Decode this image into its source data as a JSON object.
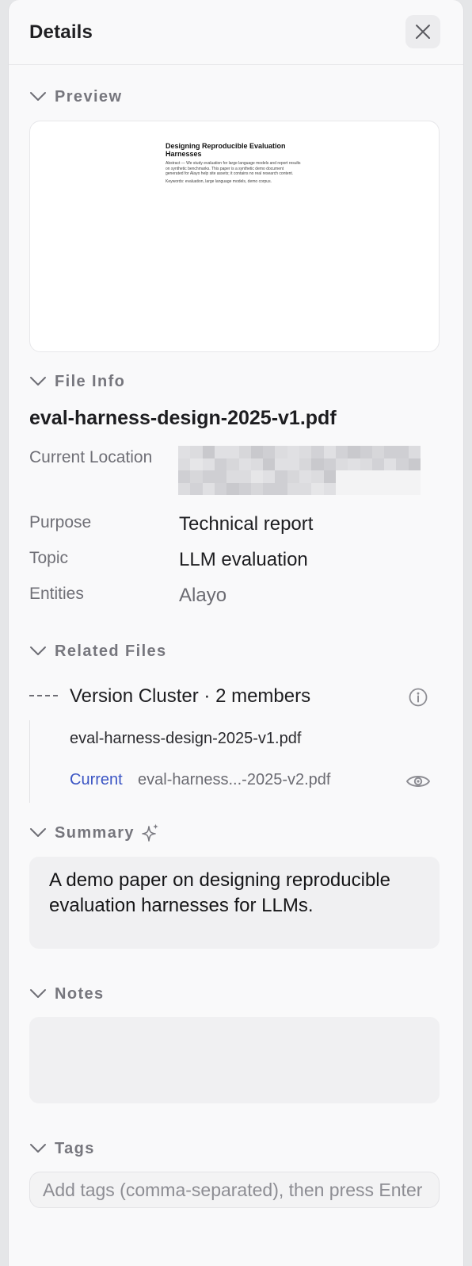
{
  "header": {
    "title": "Details"
  },
  "icons": {
    "close": "close-icon",
    "chevron": "chevron-down-icon",
    "sparkle": "sparkle-icon",
    "info": "info-icon",
    "eye": "eye-icon"
  },
  "sections": {
    "preview": "Preview",
    "file_info": "File Info",
    "related_files": "Related Files",
    "summary": "Summary",
    "notes": "Notes",
    "tags": "Tags"
  },
  "preview": {
    "doc_title": "Designing Reproducible Evaluation Harnesses",
    "doc_abstract": "Abstract — We study evaluation for large language models and report results on synthetic benchmarks. This paper is a synthetic demo document generated for Alayo help site assets; it contains no real research content.",
    "doc_keywords": "Keywords: evaluation, large language models, demo corpus."
  },
  "file_info": {
    "filename": "eval-harness-design-2025-v1.pdf",
    "location_label": "Current Location",
    "purpose_label": "Purpose",
    "purpose_value": "Technical report",
    "topic_label": "Topic",
    "topic_value": "LLM evaluation",
    "entities_label": "Entities",
    "entities_value": "Alayo"
  },
  "related": {
    "cluster_title": "Version Cluster · 2 members",
    "members": [
      {
        "name": "eval-harness-design-2025-v1.pdf"
      },
      {
        "badge": "Current",
        "name": "eval-harness...-2025-v2.pdf"
      }
    ]
  },
  "summary": {
    "text": "A demo paper on designing reproducible evaluation harnesses for LLMs."
  },
  "notes": {
    "text": ""
  },
  "tags": {
    "placeholder": "Add tags (comma-separated), then press Enter"
  },
  "colors": {
    "accent": "#3b55c4",
    "muted": "#76767d",
    "surface": "#f0f0f2"
  }
}
